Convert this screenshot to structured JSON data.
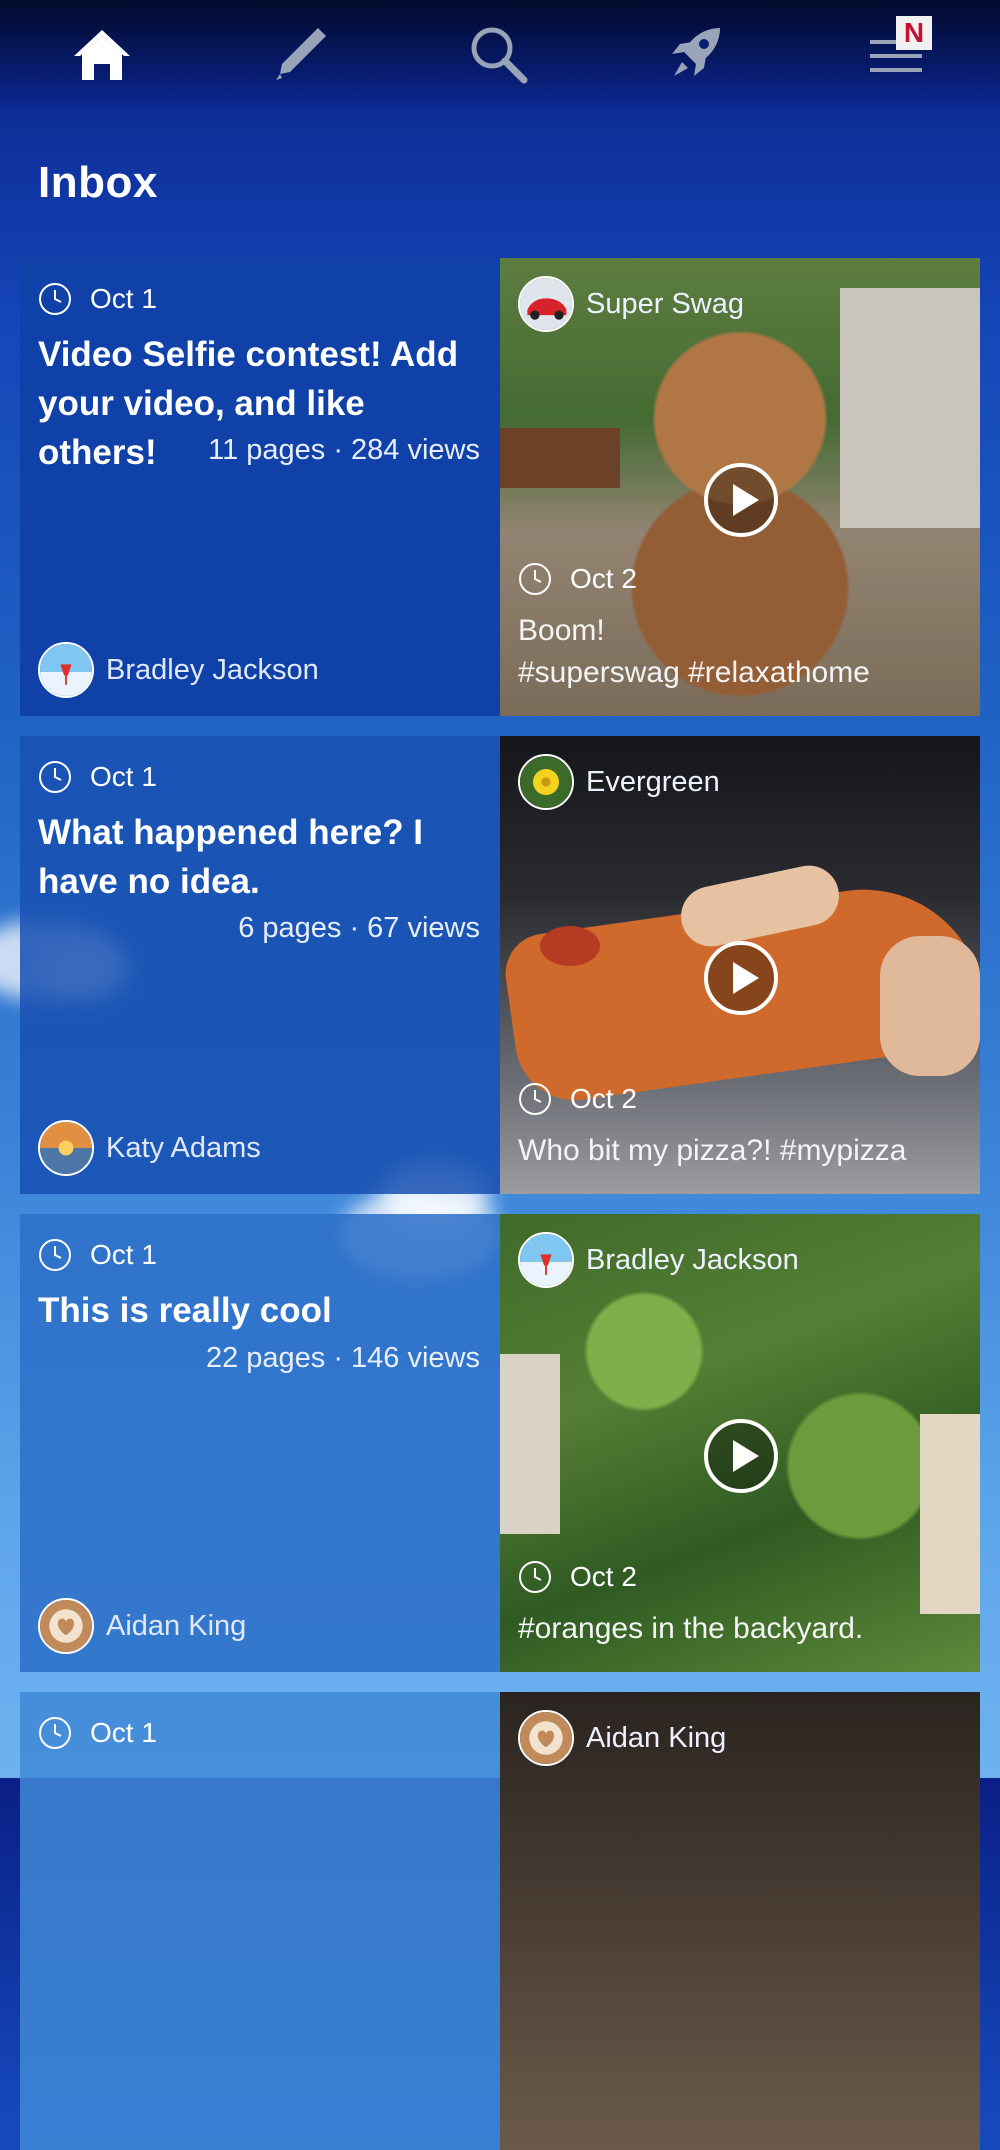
{
  "nav": {
    "items": [
      "home-icon",
      "pencil-icon",
      "search-icon",
      "rocket-icon",
      "menu-icon"
    ],
    "menu_badge": "N"
  },
  "page": {
    "title": "Inbox"
  },
  "posts": [
    {
      "date": "Oct 1",
      "title": "Video Selfie contest! Add your video, and like others!",
      "stats": "11 pages · 284 views",
      "author": "Bradley Jackson",
      "preview": {
        "author": "Super Swag",
        "date": "Oct 2",
        "caption_lines": [
          "Boom!",
          "#superswag #relaxathome"
        ]
      }
    },
    {
      "date": "Oct 1",
      "title": "What happened here? I have no idea.",
      "stats": "6 pages · 67 views",
      "author": "Katy Adams",
      "preview": {
        "author": "Evergreen",
        "date": "Oct 2",
        "caption_lines": [
          "Who bit my pizza?! #mypizza"
        ]
      }
    },
    {
      "date": "Oct 1",
      "title": "This is really cool",
      "stats": "22 pages · 146 views",
      "author": "Aidan King",
      "preview": {
        "author": "Bradley Jackson",
        "date": "Oct 2",
        "caption_lines": [
          "#oranges in the backyard."
        ]
      }
    },
    {
      "date": "Oct 1",
      "preview": {
        "author": "Aidan King"
      }
    }
  ]
}
